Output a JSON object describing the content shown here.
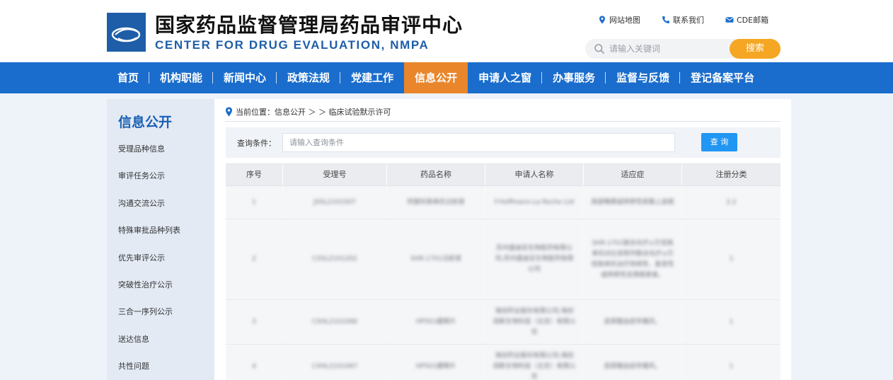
{
  "site": {
    "title": "国家药品监督管理局药品审评中心",
    "subtitle": "CENTER FOR DRUG EVALUATION, NMPA"
  },
  "toplinks": [
    {
      "label": "网站地图",
      "icon": "map-pin-icon"
    },
    {
      "label": "联系我们",
      "icon": "phone-icon"
    },
    {
      "label": "CDE邮箱",
      "icon": "mail-icon"
    }
  ],
  "search": {
    "placeholder": "请输入关键词",
    "button": "搜索"
  },
  "nav": [
    {
      "label": "首页"
    },
    {
      "label": "机构职能"
    },
    {
      "label": "新闻中心"
    },
    {
      "label": "政策法规"
    },
    {
      "label": "党建工作"
    },
    {
      "label": "信息公开",
      "active": true
    },
    {
      "label": "申请人之窗"
    },
    {
      "label": "办事服务"
    },
    {
      "label": "监督与反馈"
    },
    {
      "label": "登记备案平台"
    }
  ],
  "sidebar": {
    "title": "信息公开",
    "items": [
      "受理品种信息",
      "审评任务公示",
      "沟通交流公示",
      "特殊审批品种列表",
      "优先审评公示",
      "突破性治疗公示",
      "三合一序列公示",
      "送达信息",
      "共性问题"
    ]
  },
  "breadcrumb": {
    "prefix": "当前位置：",
    "path": "信息公开 ＞ ＞ 临床试验默示许可"
  },
  "query": {
    "label": "查询条件：",
    "placeholder": "请输入查询条件",
    "button": "查 询"
  },
  "table": {
    "headers": [
      "序号",
      "受理号",
      "药品名称",
      "申请人名称",
      "适应症",
      "注册分类"
    ],
    "rows": [
      [
        "1",
        "JXSL2101007",
        "阿替利珠单抗注射液",
        "F.Hoffmann-La Roche Ltd",
        "局部晚期或转移性尿路上皮癌",
        "2.2"
      ],
      [
        "2",
        "CXSL2101202",
        "SHR-1701注射液",
        "苏州盛迪亚生物医药有限公司;苏州盛迪亚生物医药有限公司",
        "SHR-1701联合化疗±贝伐珠单抗对比安慰剂联合化疗±贝伐珠单抗治疗持续性、复发性或转移性宫颈癌患者。",
        "1"
      ],
      [
        "3",
        "CXHL2101066",
        "HP501缓释片",
        "海创药业股份有限公司;海创润新生物科技（北京）有限公司",
        "高尿酸血症伴痛风。",
        "1"
      ],
      [
        "4",
        "CXHL2101067",
        "HP501缓释片",
        "海创药业股份有限公司;海创润新生物科技（北京）有限公司",
        "高尿酸血症伴痛风。",
        "1"
      ]
    ]
  }
}
